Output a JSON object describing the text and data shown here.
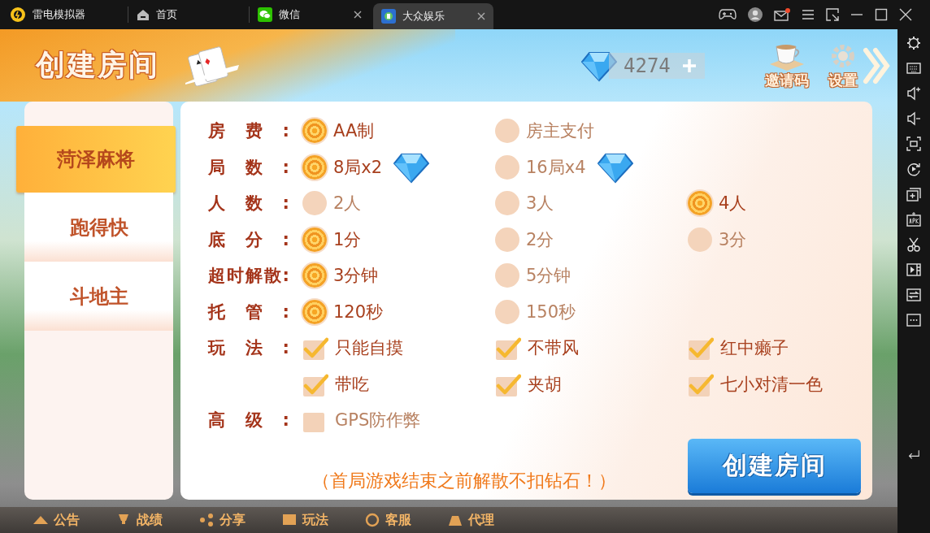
{
  "titlebar": {
    "app_name": "雷电模拟器",
    "tabs": [
      {
        "label": "首页",
        "selected": false,
        "closable": false
      },
      {
        "label": "微信",
        "selected": false,
        "closable": true
      },
      {
        "label": "大众娱乐",
        "selected": true,
        "closable": true
      }
    ]
  },
  "header": {
    "title": "创建房间",
    "diamonds": "4274",
    "invite_label": "邀请码",
    "settings_label": "设置"
  },
  "games": [
    {
      "label": "菏泽麻将",
      "selected": true
    },
    {
      "label": "跑得快",
      "selected": false
    },
    {
      "label": "斗地主",
      "selected": false
    }
  ],
  "options": [
    {
      "label": "房费:",
      "kind": "radio",
      "choices": [
        {
          "text": "AA制",
          "selected": true
        },
        {
          "text": "房主支付",
          "selected": false
        }
      ]
    },
    {
      "label": "局数:",
      "kind": "radio",
      "choices": [
        {
          "text": "8局x2",
          "selected": true,
          "diamond": true
        },
        {
          "text": "16局x4",
          "selected": false,
          "diamond": true
        }
      ]
    },
    {
      "label": "人数:",
      "kind": "radio",
      "choices": [
        {
          "text": "2人",
          "selected": false
        },
        {
          "text": "3人",
          "selected": false
        },
        {
          "text": "4人",
          "selected": true
        }
      ]
    },
    {
      "label": "底分:",
      "kind": "radio",
      "choices": [
        {
          "text": "1分",
          "selected": true
        },
        {
          "text": "2分",
          "selected": false
        },
        {
          "text": "3分",
          "selected": false
        }
      ]
    },
    {
      "label": "超时解散:",
      "kind": "radio",
      "choices": [
        {
          "text": "3分钟",
          "selected": true
        },
        {
          "text": "5分钟",
          "selected": false
        }
      ]
    },
    {
      "label": "托管:",
      "kind": "radio",
      "choices": [
        {
          "text": "120秒",
          "selected": true
        },
        {
          "text": "150秒",
          "selected": false
        }
      ]
    },
    {
      "label": "玩法:",
      "kind": "check",
      "choices": [
        {
          "text": "只能自摸",
          "checked": true
        },
        {
          "text": "不带风",
          "checked": true
        },
        {
          "text": "红中癞子",
          "checked": true
        },
        {
          "text": "带吃",
          "checked": true
        },
        {
          "text": "夹胡",
          "checked": true
        },
        {
          "text": "七小对清一色",
          "checked": true
        }
      ]
    },
    {
      "label": "高级:",
      "kind": "check",
      "choices": [
        {
          "text": "GPS防作弊",
          "checked": false
        }
      ]
    }
  ],
  "notice": "（首局游戏结束之前解散不扣钻石！）",
  "create_button": "创建房间",
  "bottom_nav": [
    "公告",
    "战绩",
    "分享",
    "玩法",
    "客服",
    "代理"
  ]
}
